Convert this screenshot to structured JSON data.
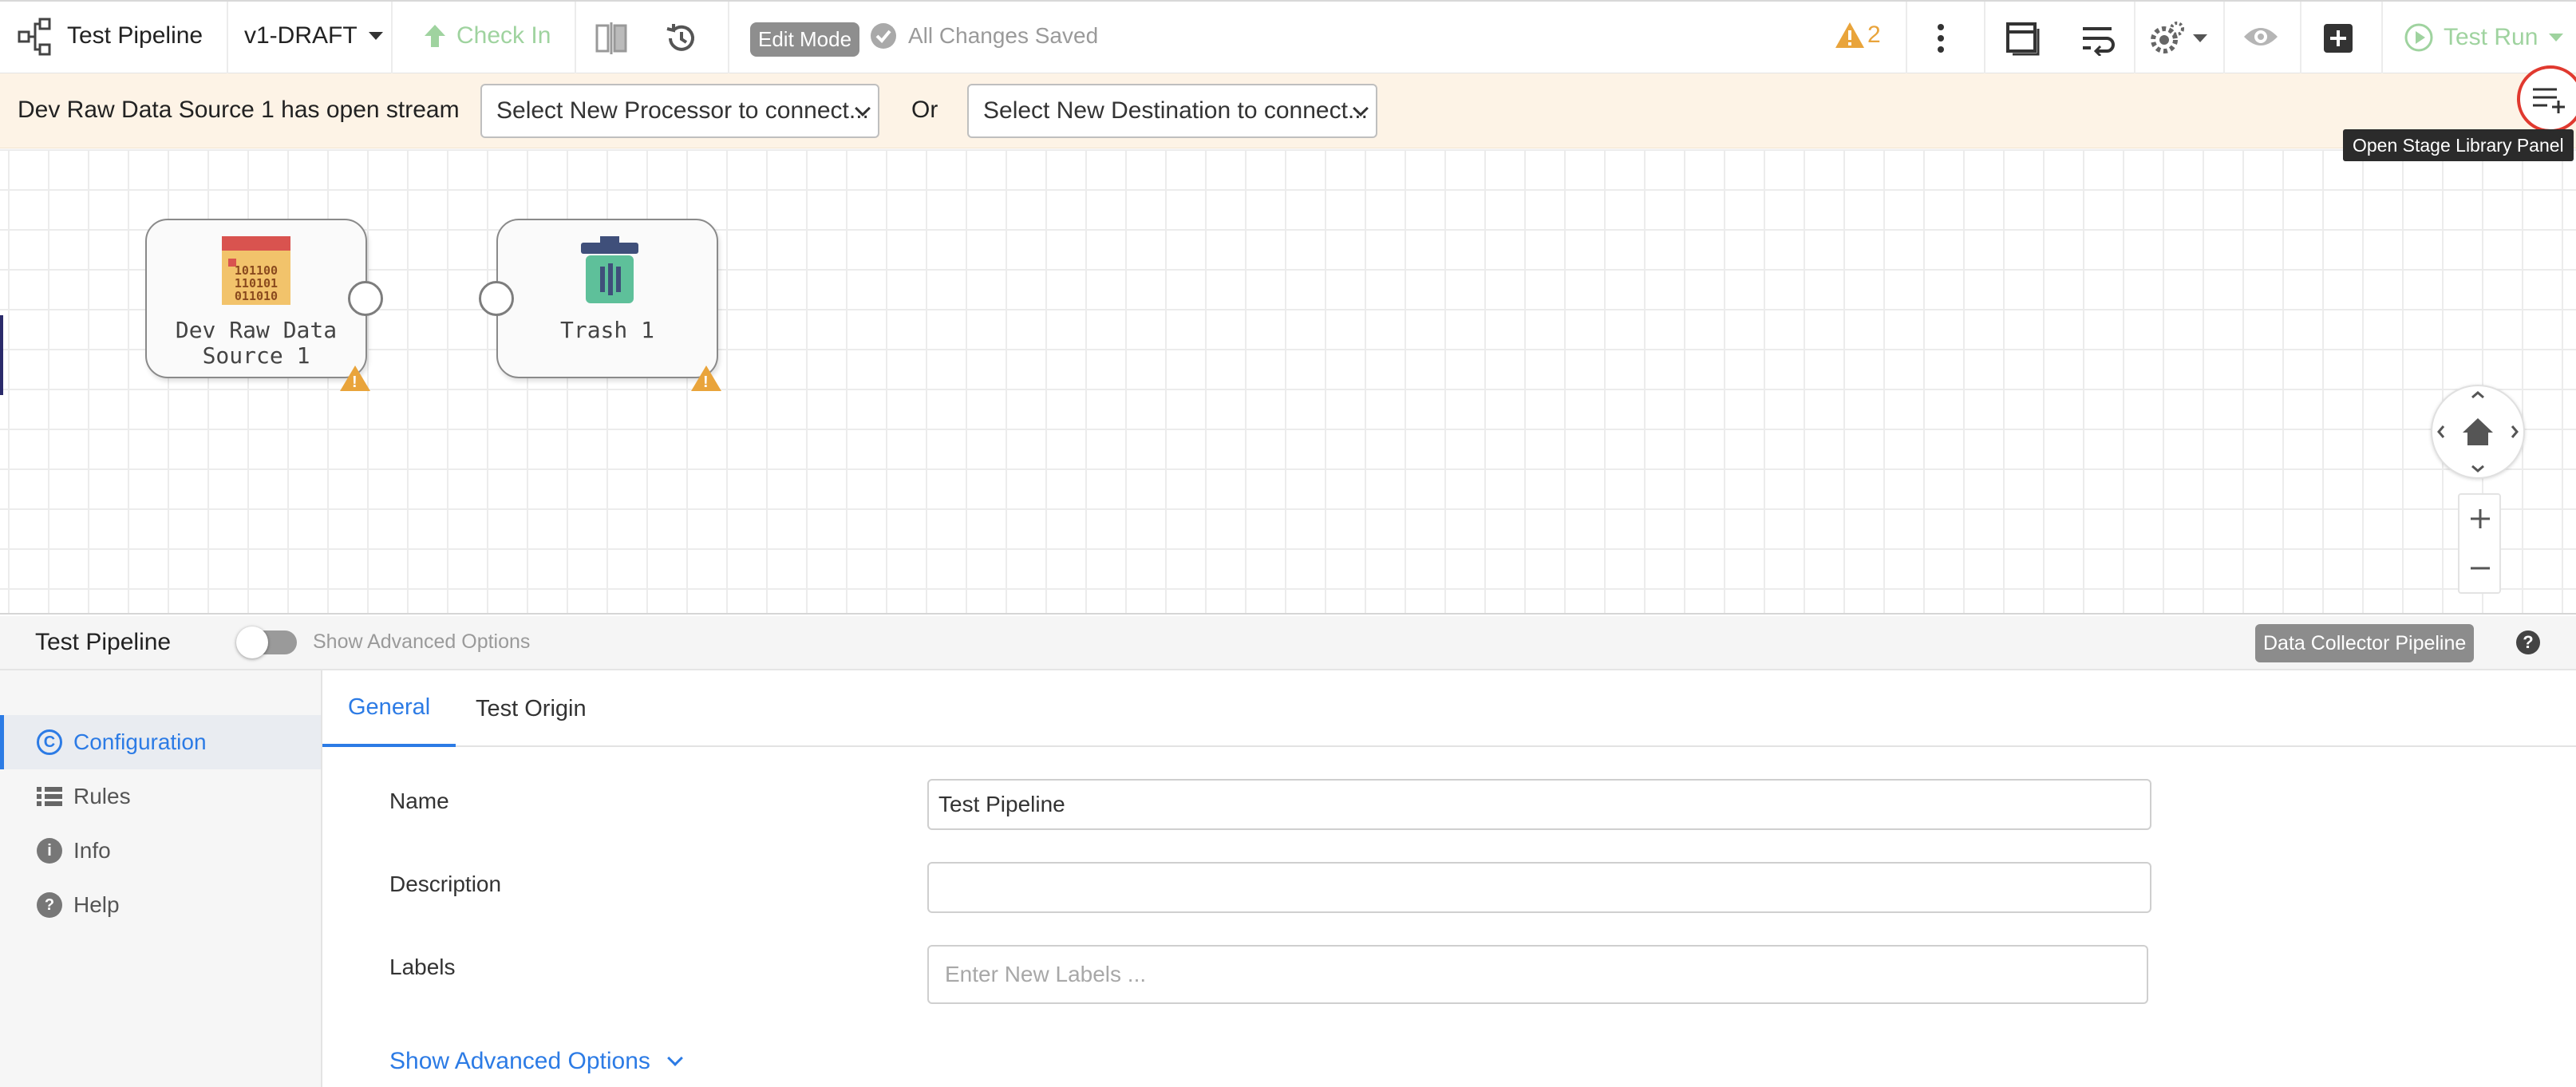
{
  "header": {
    "pipeline_title": "Test Pipeline",
    "version": "v1-DRAFT",
    "check_in_label": "Check In",
    "mode_badge": "Edit Mode",
    "save_status": "All Changes Saved",
    "issues_count": "2",
    "test_run_label": "Test Run",
    "accent_color": "#2c7be5",
    "warning_color": "#e9a43b"
  },
  "alert": {
    "message": "Dev Raw Data Source 1 has open stream",
    "processor_select": "Select New Processor to connect...",
    "or_label": "Or",
    "destination_select": "Select New Destination to connect...",
    "tooltip": "Open Stage Library Panel"
  },
  "canvas": {
    "stages": [
      {
        "label": "Dev Raw Data Source 1",
        "icon": "binary-data-icon"
      },
      {
        "label": "Trash 1",
        "icon": "trash-icon"
      }
    ]
  },
  "properties": {
    "title": "Test Pipeline",
    "toggle_label": "Show Advanced Options",
    "pipeline_type": "Data Collector Pipeline",
    "help": "?",
    "nav": [
      {
        "label": "Configuration",
        "icon": "configuration-icon"
      },
      {
        "label": "Rules",
        "icon": "list-icon"
      },
      {
        "label": "Info",
        "icon": "info-icon"
      },
      {
        "label": "Help",
        "icon": "help-icon"
      }
    ],
    "tabs": [
      "General",
      "Test Origin"
    ],
    "fields": {
      "name_label": "Name",
      "name_value": "Test Pipeline",
      "description_label": "Description",
      "description_value": "",
      "labels_label": "Labels",
      "labels_placeholder": "Enter New Labels ..."
    },
    "advanced_link": "Show Advanced Options"
  }
}
